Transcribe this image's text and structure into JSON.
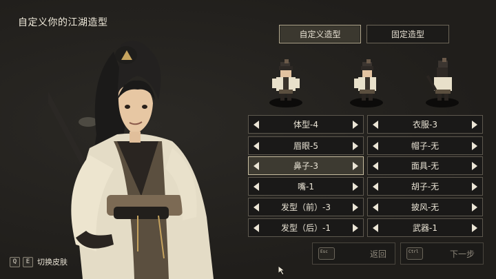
{
  "page_title": "自定义你的江湖造型",
  "tabs": [
    {
      "label": "自定义造型",
      "active": true
    },
    {
      "label": "固定造型",
      "active": false
    }
  ],
  "options_left": [
    {
      "label": "体型-4"
    },
    {
      "label": "眉眼-5"
    },
    {
      "label": "鼻子-3",
      "selected": true
    },
    {
      "label": "嘴-1"
    },
    {
      "label": "发型（前）-3"
    },
    {
      "label": "发型（后）-1"
    }
  ],
  "options_right": [
    {
      "label": "衣服-3"
    },
    {
      "label": "帽子-无"
    },
    {
      "label": "面具-无"
    },
    {
      "label": "胡子-无"
    },
    {
      "label": "披风-无"
    },
    {
      "label": "武器-1"
    }
  ],
  "buttons": {
    "back": {
      "label": "返回",
      "key": "Esc"
    },
    "next": {
      "label": "下一步",
      "key": "Ctrl"
    }
  },
  "skin_hint": {
    "key_left": "Q",
    "key_right": "E",
    "label": "切换皮肤"
  },
  "colors": {
    "background": "#211f1c",
    "panel": "#1a1918",
    "border": "#5e594f",
    "selected": "#3d3a31",
    "text": "#ebe5d6"
  },
  "sprites": [
    "sprite-front",
    "sprite-three-quarter",
    "sprite-back"
  ]
}
